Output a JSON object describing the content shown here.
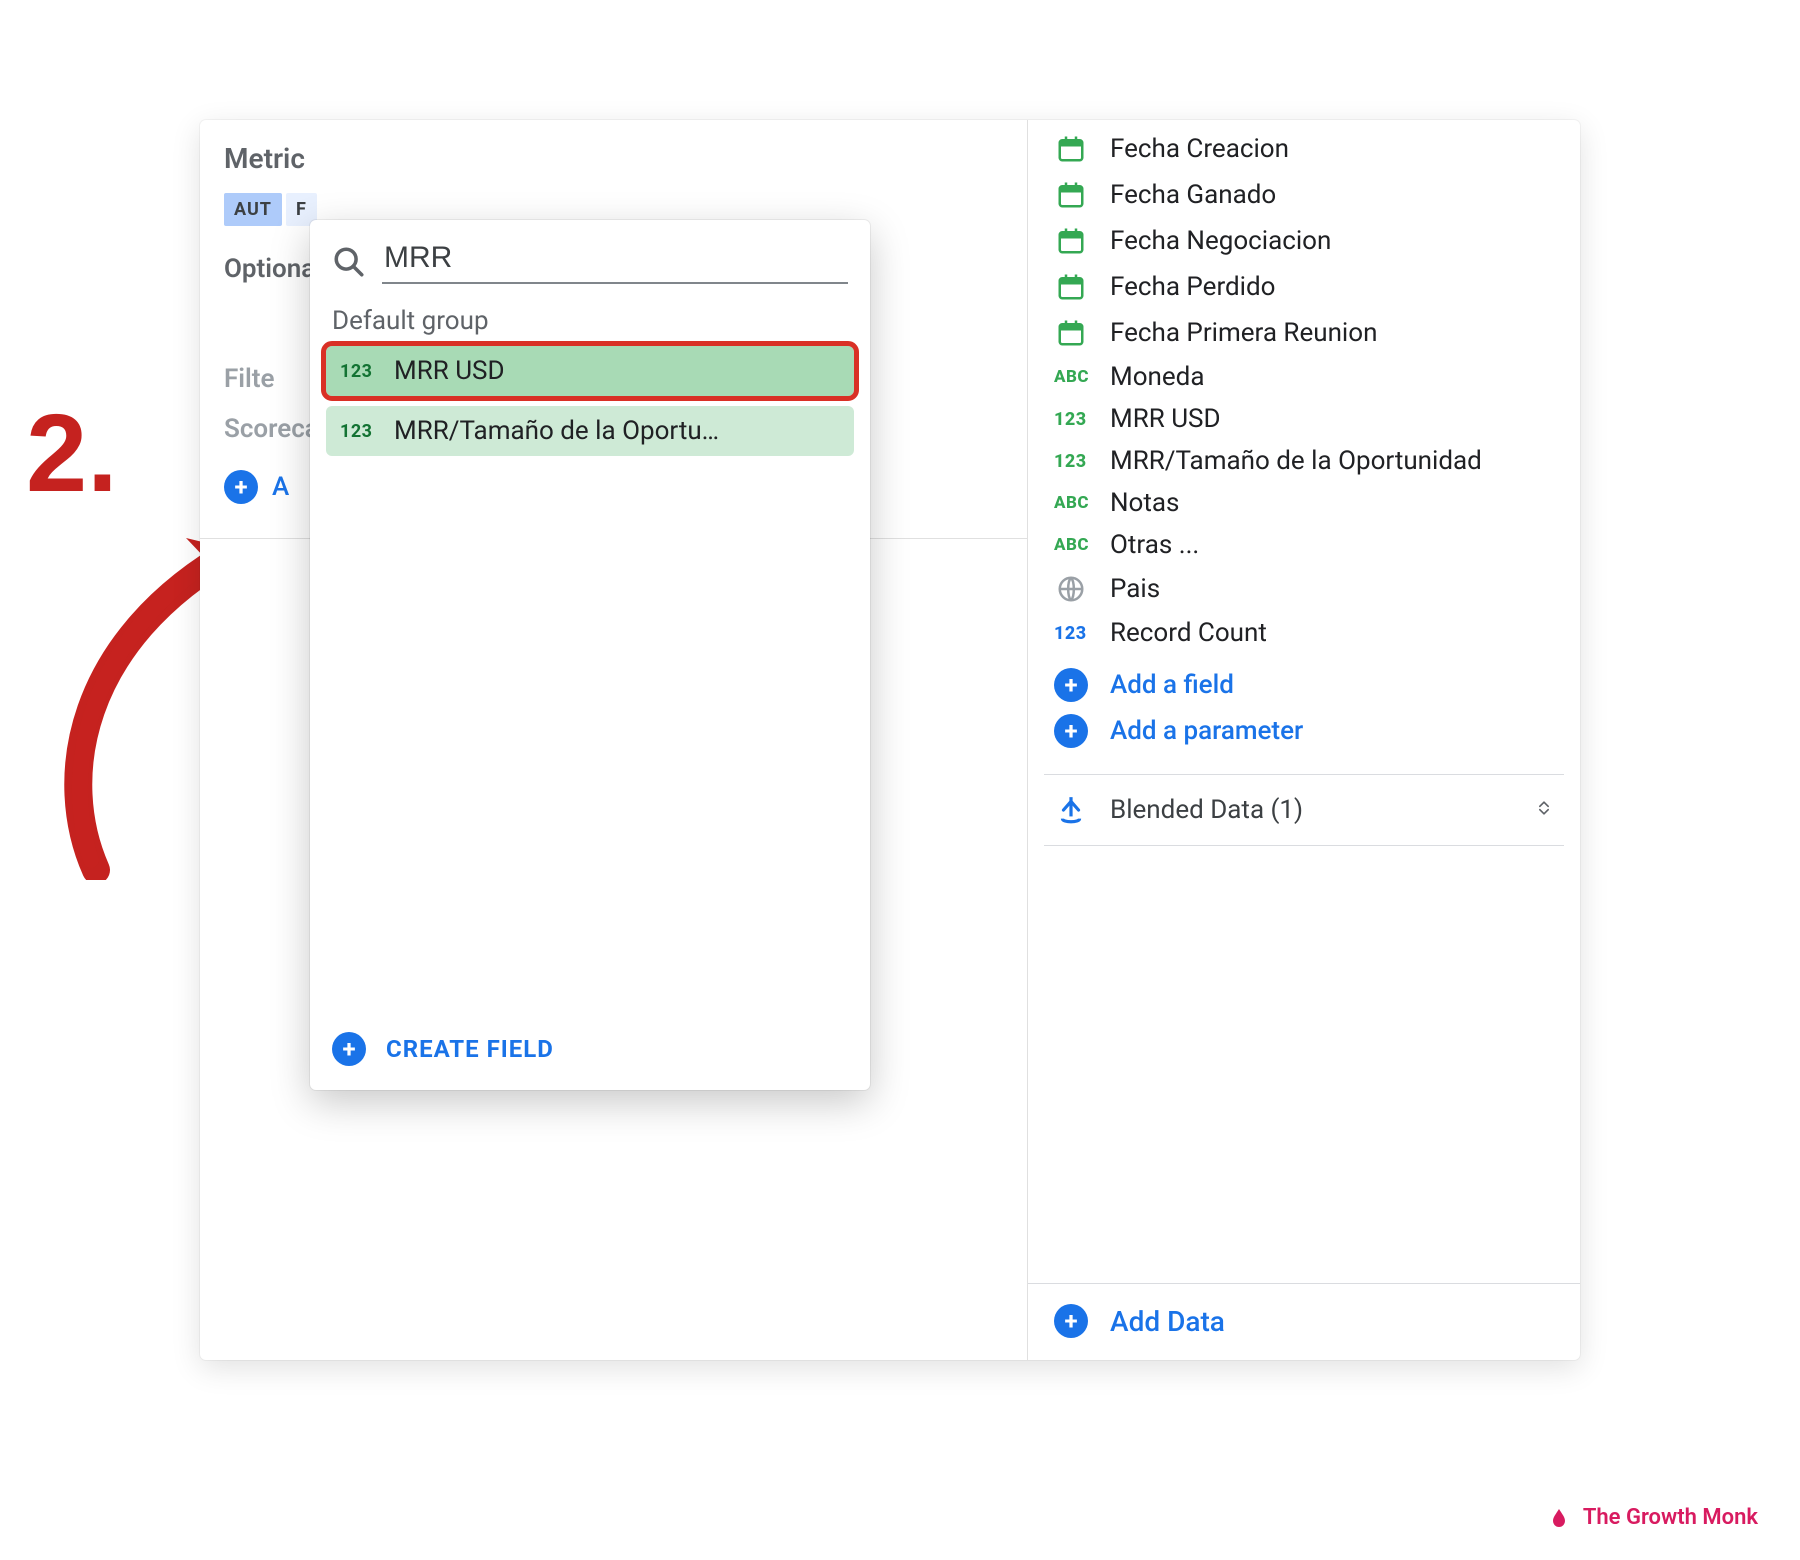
{
  "annotation": {
    "step_number": "2."
  },
  "left_panel": {
    "metric_label": "Metric",
    "chips": [
      "AUT",
      "F"
    ],
    "optional_label": "Optiona",
    "filter_label": "Filte",
    "scorecard_label": "Scoreca",
    "add_button_truncated": "A"
  },
  "dropdown": {
    "search_value": "MRR",
    "group_label": "Default group",
    "items": [
      {
        "type": "123",
        "label": "MRR USD",
        "highlight": true
      },
      {
        "type": "123",
        "label": "MRR/Tamaño de la Oportu…",
        "highlight": false
      }
    ],
    "create_field_label": "CREATE FIELD"
  },
  "right_panel": {
    "fields": [
      {
        "icon": "calendar",
        "label": "Fecha Creacion"
      },
      {
        "icon": "calendar",
        "label": "Fecha Ganado"
      },
      {
        "icon": "calendar",
        "label": "Fecha Negociacion"
      },
      {
        "icon": "calendar",
        "label": "Fecha Perdido"
      },
      {
        "icon": "calendar",
        "label": "Fecha Primera Reunion"
      },
      {
        "icon": "abc",
        "label": "Moneda"
      },
      {
        "icon": "123",
        "label": "MRR USD"
      },
      {
        "icon": "123",
        "label": "MRR/Tamaño de la Oportunidad"
      },
      {
        "icon": "abc",
        "label": "Notas"
      },
      {
        "icon": "abc",
        "label": "Otras ..."
      },
      {
        "icon": "globe",
        "label": "Pais"
      },
      {
        "icon": "123-blue",
        "label": "Record Count"
      }
    ],
    "abc_text": "ABC",
    "num_text": "123",
    "add_field_label": "Add a field",
    "add_parameter_label": "Add a parameter",
    "blended_label": "Blended Data (1)",
    "add_data_label": "Add Data"
  },
  "watermark": {
    "text": "The Growth Monk"
  }
}
